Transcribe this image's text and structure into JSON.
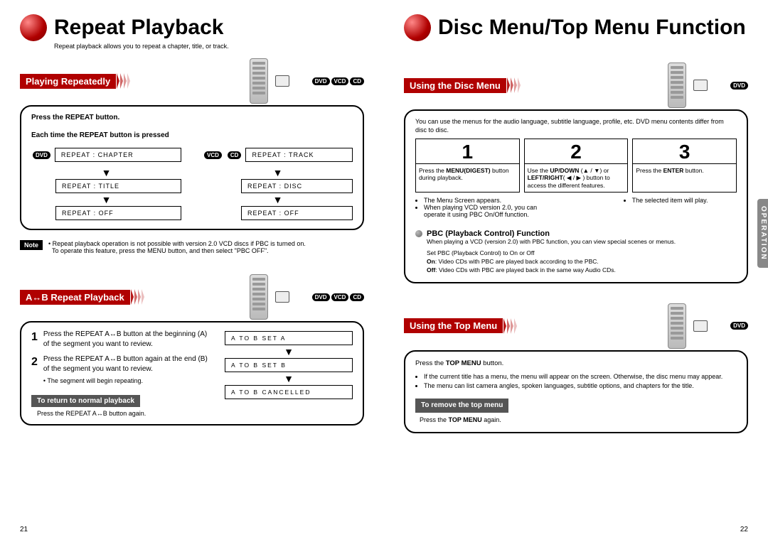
{
  "left": {
    "page_number": "21",
    "title": "Repeat Playback",
    "subtitle": "Repeat playback allows you to repeat a chapter, title, or track.",
    "section1": {
      "tab": "Playing Repeatedly",
      "discs": [
        "DVD",
        "VCD",
        "CD"
      ],
      "line1": "Press the REPEAT button.",
      "line2": "Each time the REPEAT button is pressed",
      "left_media": "DVD",
      "left_flow": [
        "REPEAT : CHAPTER",
        "REPEAT : TITLE",
        "REPEAT : OFF"
      ],
      "right_media1": "VCD",
      "right_media2": "CD",
      "right_flow": [
        "REPEAT : TRACK",
        "REPEAT : DISC",
        "REPEAT : OFF"
      ],
      "note_label": "Note",
      "note1": "Repeat playback operation is not possible with version 2.0 VCD discs if PBC is turned on.",
      "note2": "To operate this feature, press the MENU button, and then select \"PBC OFF\"."
    },
    "section2": {
      "tab": "A↔B Repeat Playback",
      "discs": [
        "DVD",
        "VCD",
        "CD"
      ],
      "step1": "Press the REPEAT A↔B button at the beginning (A) of the segment you want to review.",
      "step2": "Press the REPEAT A↔B button again at the end (B) of the segment you want to review.",
      "step2_sub": "The segment will begin repeating.",
      "return_bar": "To return to normal playback",
      "return_text": "Press the REPEAT A↔B button again.",
      "flow": [
        "A  TO  B      SET  A",
        "A  TO  B      SET  B",
        "A  TO  B      CANCELLED"
      ]
    }
  },
  "right": {
    "page_number": "22",
    "side_tab": "OPERATION",
    "title": "Disc Menu/Top Menu Function",
    "section1": {
      "tab": "Using the Disc Menu",
      "discs": [
        "DVD"
      ],
      "intro": "You can use the menus for the audio language, subtitle language, profile, etc. DVD menu contents differ from disc to disc.",
      "step1_num": "1",
      "step1_text_a": "Press the ",
      "step1_text_b": "MENU(DIGEST)",
      "step1_text_c": " button during playback.",
      "step2_num": "2",
      "step2_text_a": "Use the ",
      "step2_text_b": "UP/DOWN",
      "step2_text_c": " (▲ / ▼) or ",
      "step2_text_d": "LEFT/RIGHT",
      "step2_text_e": "( ◀ / ▶ ) button to access the different features.",
      "step3_num": "3",
      "step3_text_a": "Press the ",
      "step3_text_b": "ENTER",
      "step3_text_c": " button.",
      "bullets_left": [
        "The Menu Screen appears.",
        "When playing VCD version 2.0, you can operate it using PBC On/Off function."
      ],
      "bullets_right": [
        "The selected item will play."
      ],
      "pbc_title": "PBC (Playback Control) Function",
      "pbc_line1": "When playing a VCD (version 2.0) with PBC function, you can view special scenes or menus.",
      "pbc_line2": "Set PBC (Playback Control) to On or Off",
      "pbc_on": "On: Video CDs with PBC are played back according to the PBC.",
      "pbc_off": "Off: Video CDs with PBC are played back in the same way Audio CDs."
    },
    "section2": {
      "tab": "Using the Top Menu",
      "discs": [
        "DVD"
      ],
      "line1_a": "Press the ",
      "line1_b": "TOP MENU",
      "line1_c": " button.",
      "bullets": [
        "If the current title has a menu, the menu will appear on the screen. Otherwise, the disc menu may appear.",
        "The menu can list camera angles, spoken languages, subtitle options, and chapters for the title."
      ],
      "remove_bar": "To remove the top menu",
      "remove_text_a": "Press the ",
      "remove_text_b": "TOP MENU",
      "remove_text_c": " again."
    }
  }
}
